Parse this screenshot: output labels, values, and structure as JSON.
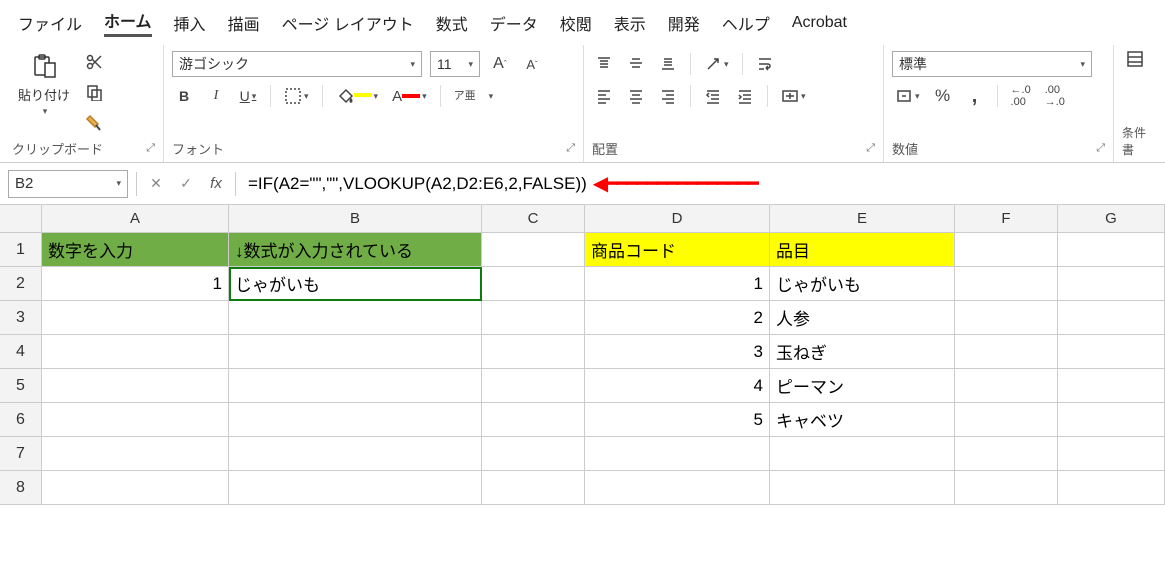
{
  "menu": {
    "items": [
      "ファイル",
      "ホーム",
      "挿入",
      "描画",
      "ページ レイアウト",
      "数式",
      "データ",
      "校閲",
      "表示",
      "開発",
      "ヘルプ",
      "Acrobat"
    ],
    "active": 1
  },
  "ribbon": {
    "clipboard": {
      "paste": "貼り付け",
      "label": "クリップボード"
    },
    "font": {
      "name": "游ゴシック",
      "size": "11",
      "ruby": "ア亜",
      "label": "フォント"
    },
    "align": {
      "label": "配置"
    },
    "number": {
      "format": "標準",
      "label": "数値"
    },
    "cond": {
      "label": "条件書"
    }
  },
  "formula": {
    "cellref": "B2",
    "value": "=IF(A2=\"\",\"\",VLOOKUP(A2,D2:E6,2,FALSE))"
  },
  "grid": {
    "cols": [
      "A",
      "B",
      "C",
      "D",
      "E",
      "F",
      "G"
    ],
    "rows": [
      "1",
      "2",
      "3",
      "4",
      "5",
      "6",
      "7",
      "8"
    ],
    "a1": "数字を入力",
    "b1": "↓数式が入力されている",
    "d1": "商品コード",
    "e1": "品目",
    "a2": "1",
    "b2": "じゃがいも",
    "d2": "1",
    "e2": "じゃがいも",
    "d3": "2",
    "e3": "人参",
    "d4": "3",
    "e4": "玉ねぎ",
    "d5": "4",
    "e5": "ピーマン",
    "d6": "5",
    "e6": "キャベツ"
  }
}
